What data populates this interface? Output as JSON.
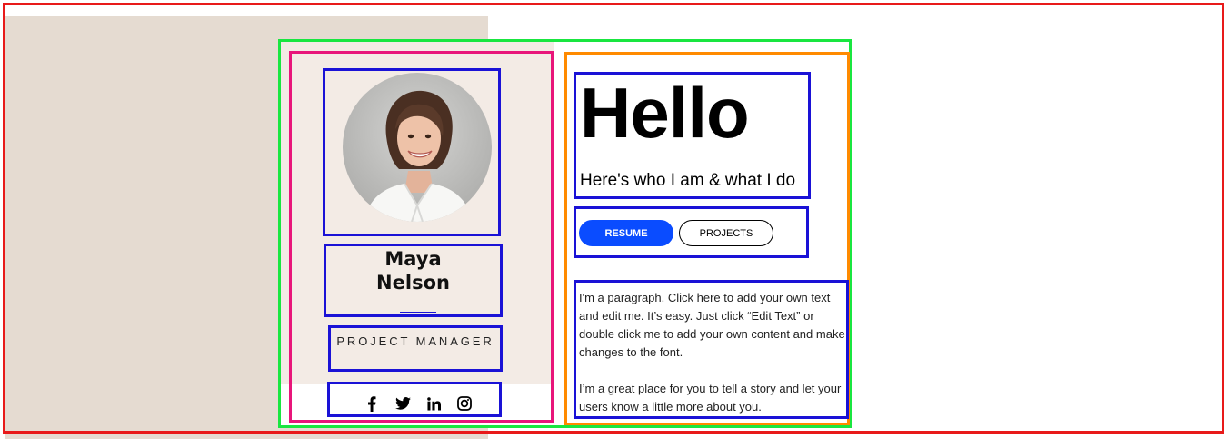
{
  "profile": {
    "first_name": "Maya",
    "last_name": "Nelson",
    "role": "PROJECT MANAGER",
    "avatar_icon": "portrait-photo"
  },
  "hero": {
    "greeting": "Hello",
    "subtitle": "Here's who I am & what I do"
  },
  "buttons": {
    "resume": "RESUME",
    "projects": "PROJECTS"
  },
  "about": {
    "paragraph_1": "I'm a paragraph. Click here to add your own text and edit me. It’s easy. Just click “Edit Text” or double click me to add your own content and make changes to the font.",
    "paragraph_2": "I’m a great place for you to tell a story and let your users know a little more about you."
  },
  "social": [
    {
      "icon": "facebook-icon"
    },
    {
      "icon": "twitter-icon"
    },
    {
      "icon": "linkedin-icon"
    },
    {
      "icon": "instagram-icon"
    }
  ],
  "colors": {
    "accent_blue": "#0a4cff",
    "beige": "#e5dbd1",
    "card_bg": "#f3ebe5",
    "frame_red": "#e81a1a",
    "frame_green": "#19e640",
    "frame_pink": "#e8157a",
    "frame_orange": "#ff8a00",
    "box_blue": "#1a12d6"
  }
}
